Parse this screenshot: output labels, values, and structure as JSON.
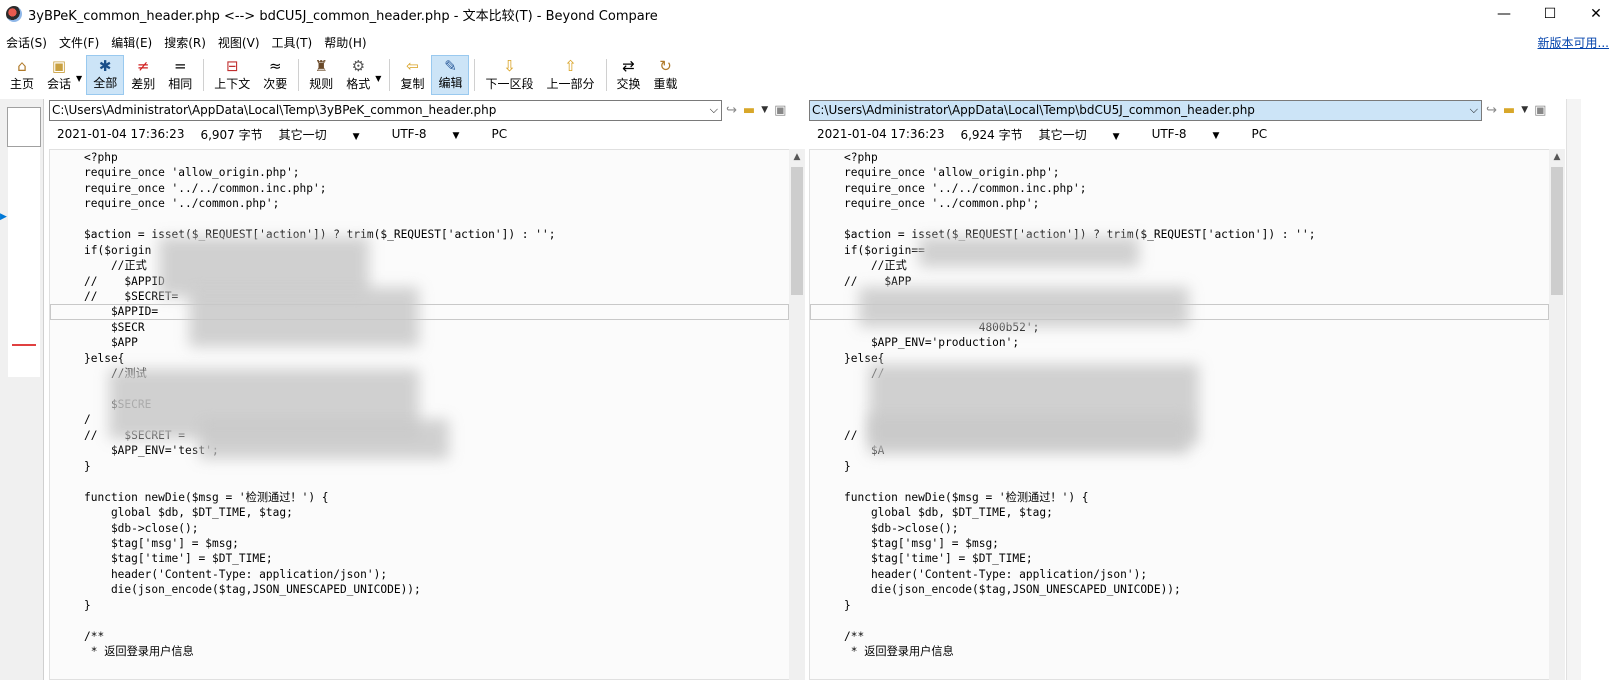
{
  "window": {
    "title": "3yBPeK_common_header.php <--> bdCU5J_common_header.php - 文本比较(T) - Beyond Compare",
    "minimize": "—",
    "maximize": "☐",
    "close": "✕"
  },
  "menu": [
    "会话(S)",
    "文件(F)",
    "编辑(E)",
    "搜索(R)",
    "视图(V)",
    "工具(T)",
    "帮助(H)"
  ],
  "new_version_link": "新版本可用...",
  "toolbar": {
    "home": {
      "label": "主页",
      "icon": "⌂"
    },
    "session": {
      "label": "会话",
      "icon": "▣"
    },
    "all": {
      "label": "全部",
      "icon": "✱"
    },
    "diff": {
      "label": "差别",
      "icon": "≠"
    },
    "same": {
      "label": "相同",
      "icon": "="
    },
    "context": {
      "label": "上下文",
      "icon": "⊟"
    },
    "minor": {
      "label": "次要",
      "icon": "≈"
    },
    "rules": {
      "label": "规则",
      "icon": "♜"
    },
    "format": {
      "label": "格式",
      "icon": "⚙"
    },
    "copy": {
      "label": "复制",
      "icon": "⇦"
    },
    "edit": {
      "label": "编辑",
      "icon": "✎"
    },
    "next_section": {
      "label": "下一区段",
      "icon": "⇩"
    },
    "prev_part": {
      "label": "上一部分",
      "icon": "⇧"
    },
    "swap": {
      "label": "交换",
      "icon": "⇄"
    },
    "reload": {
      "label": "重载",
      "icon": "↻"
    }
  },
  "left": {
    "path": "C:\\Users\\Administrator\\AppData\\Local\\Temp\\3yBPeK_common_header.php",
    "date": "2021-01-04 17:36:23",
    "size": "6,907 字节",
    "encoding_mode": "其它一切",
    "charset": "UTF-8",
    "line_ending": "PC"
  },
  "right": {
    "path": "C:\\Users\\Administrator\\AppData\\Local\\Temp\\bdCU5J_common_header.php",
    "date": "2021-01-04 17:36:23",
    "size": "6,924 字节",
    "encoding_mode": "其它一切",
    "charset": "UTF-8",
    "line_ending": "PC"
  },
  "left_code": [
    {
      "text": "<?php"
    },
    {
      "text": "require_once 'allow_origin.php';"
    },
    {
      "text": "require_once '../../common.inc.php';"
    },
    {
      "text": "require_once '../common.php';"
    },
    {
      "text": ""
    },
    {
      "text": "$action = isset($_REQUEST['action']) ? trim($_REQUEST['action']) : '';"
    },
    {
      "text": "if($origin"
    },
    {
      "text": "    //正式"
    },
    {
      "text": "//    $APPID"
    },
    {
      "text": "//    $SECRET="
    },
    {
      "text": "    $APPID="
    },
    {
      "text": "    $SECR"
    },
    {
      "text": "    $APP"
    },
    {
      "text": "}else{"
    },
    {
      "text": "    //测试"
    },
    {
      "text": ""
    },
    {
      "text": "    $SECRE"
    },
    {
      "text": "/"
    },
    {
      "text": "//    $SECRET = "
    },
    {
      "text": "    $APP_ENV='test';"
    },
    {
      "text": "}"
    },
    {
      "text": ""
    },
    {
      "text": "function newDie($msg = '检测通过！') {"
    },
    {
      "text": "    global $db, $DT_TIME, $tag;"
    },
    {
      "text": "    $db->close();"
    },
    {
      "text": "    $tag['msg'] = $msg;"
    },
    {
      "text": "    $tag['time'] = $DT_TIME;"
    },
    {
      "text": "    header('Content-Type: application/json');"
    },
    {
      "text": "    die(json_encode($tag,JSON_UNESCAPED_UNICODE));"
    },
    {
      "text": "}"
    },
    {
      "text": ""
    },
    {
      "text": "/**"
    },
    {
      "text": " * 返回登录用户信息"
    }
  ],
  "right_code": [
    {
      "text": "<?php"
    },
    {
      "text": "require_once 'allow_origin.php';"
    },
    {
      "text": "require_once '../../common.inc.php';"
    },
    {
      "text": "require_once '../common.php';"
    },
    {
      "text": ""
    },
    {
      "text": "$action = isset($_REQUEST['action']) ? trim($_REQUEST['action']) : '';"
    },
    {
      "text": "if($origin=="
    },
    {
      "text": "    //正式"
    },
    {
      "text": "//    $APP"
    },
    {
      "text": ""
    },
    {
      "text": ""
    },
    {
      "text": "                    4800b52';"
    },
    {
      "text": "    $APP_ENV='production';"
    },
    {
      "text": "}else{"
    },
    {
      "text": "    //"
    },
    {
      "text": ""
    },
    {
      "text": ""
    },
    {
      "text": ""
    },
    {
      "text": "//"
    },
    {
      "text": "    $A"
    },
    {
      "text": "}"
    },
    {
      "text": ""
    },
    {
      "text": "function newDie($msg = '检测通过！') {"
    },
    {
      "text": "    global $db, $DT_TIME, $tag;"
    },
    {
      "text": "    $db->close();"
    },
    {
      "text": "    $tag['msg'] = $msg;"
    },
    {
      "text": "    $tag['time'] = $DT_TIME;"
    },
    {
      "text": "    header('Content-Type: application/json');"
    },
    {
      "text": "    die(json_encode($tag,JSON_UNESCAPED_UNICODE));"
    },
    {
      "text": "}"
    },
    {
      "text": ""
    },
    {
      "text": "/**"
    },
    {
      "text": " * 返回登录用户信息"
    }
  ]
}
